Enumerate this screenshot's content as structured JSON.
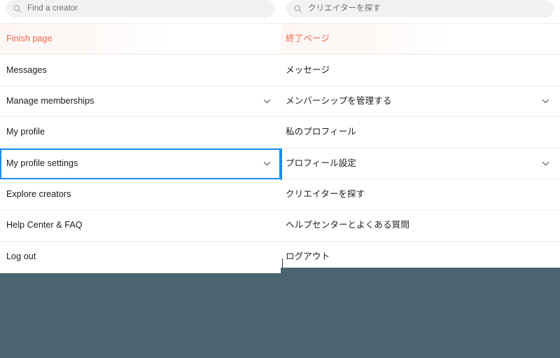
{
  "colors": {
    "accent_text": "#f4664a",
    "focus_ring": "#1a8cf0",
    "page_background": "#4a6570",
    "panel_background": "#ffffff",
    "search_field_background": "#f4f2f1",
    "divider": "#eeecec",
    "label_text": "#1a1a1a"
  },
  "left_panel": {
    "search": {
      "placeholder": "Find a creator",
      "value": "",
      "icon": "search-icon"
    },
    "menu_items": [
      {
        "label": "Finish page",
        "accent": true,
        "chevron": false,
        "focused": false
      },
      {
        "label": "Messages",
        "accent": false,
        "chevron": false,
        "focused": false
      },
      {
        "label": "Manage memberships",
        "accent": false,
        "chevron": true,
        "focused": false
      },
      {
        "label": "My profile",
        "accent": false,
        "chevron": false,
        "focused": false
      },
      {
        "label": "My profile settings",
        "accent": false,
        "chevron": true,
        "focused": true
      },
      {
        "label": "Explore creators",
        "accent": false,
        "chevron": false,
        "focused": false
      },
      {
        "label": "Help Center & FAQ",
        "accent": false,
        "chevron": false,
        "focused": false
      },
      {
        "label": "Log out",
        "accent": false,
        "chevron": false,
        "focused": false
      }
    ]
  },
  "right_panel": {
    "search": {
      "placeholder": "クリエイターを探す",
      "value": "",
      "icon": "search-icon"
    },
    "menu_items": [
      {
        "label": "終了ページ",
        "accent": true,
        "chevron": false,
        "focused": false
      },
      {
        "label": "メッセージ",
        "accent": false,
        "chevron": false,
        "focused": false
      },
      {
        "label": "メンバーシップを管理する",
        "accent": false,
        "chevron": true,
        "focused": false
      },
      {
        "label": "私のプロフィール",
        "accent": false,
        "chevron": false,
        "focused": false
      },
      {
        "label": "プロフィール設定",
        "accent": false,
        "chevron": true,
        "focused": false
      },
      {
        "label": "クリエイターを探す",
        "accent": false,
        "chevron": false,
        "focused": false
      },
      {
        "label": "ヘルプセンターとよくある質問",
        "accent": false,
        "chevron": false,
        "focused": false
      },
      {
        "label": "ログアウト",
        "accent": false,
        "chevron": false,
        "focused": false
      }
    ]
  }
}
